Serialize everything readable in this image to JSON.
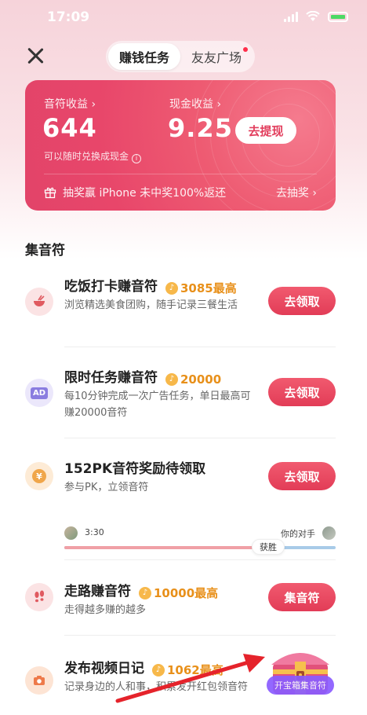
{
  "status_bar": {
    "time": "17:09"
  },
  "tabs": [
    {
      "label": "赚钱任务",
      "active": true
    },
    {
      "label": "友友广场",
      "active": false,
      "dot": true
    }
  ],
  "earnings": {
    "notes_label": "音符收益 ›",
    "notes_value": "644",
    "cash_label": "现金收益 ›",
    "cash_value": "9.25",
    "withdraw_label": "去提现",
    "hint": "可以随时兑换成现金",
    "lottery_text": "抽奖赢 iPhone 未中奖100%返还",
    "lottery_link": "去抽奖 ›"
  },
  "section": {
    "title": "集音符"
  },
  "tasks": [
    {
      "icon": "bowl-icon",
      "title": "吃饭打卡赚音符",
      "reward": "3085最高",
      "desc": "浏览精选美食团购，随手记录三餐生活",
      "button": "去领取"
    },
    {
      "icon": "ad-icon",
      "title": "限时任务赚音符",
      "reward": "20000",
      "desc": "每10分钟完成一次广告任务，单日最高可赚20000音符",
      "button": "去领取"
    },
    {
      "icon": "yen-coin-icon",
      "title": "152PK音符奖励待领取",
      "desc": "参与PK，立领音符",
      "button": "去领取",
      "pk": {
        "time": "3:30",
        "opponent": "你的对手",
        "result": "获胜",
        "progress": 0.75
      }
    },
    {
      "icon": "footprint-icon",
      "title": "走路赚音符",
      "reward": "10000最高",
      "desc": "走得越多赚的越多",
      "button": "集音符"
    },
    {
      "icon": "camera-icon",
      "title": "发布视频日记",
      "reward": "1062最高",
      "desc": "记录身边的人和事，积累发开红包领音符"
    }
  ],
  "chest": {
    "label": "开宝箱集音符"
  },
  "colors": {
    "accent": "#e23c57",
    "reward": "#e8901a",
    "card": "#e8466a"
  }
}
